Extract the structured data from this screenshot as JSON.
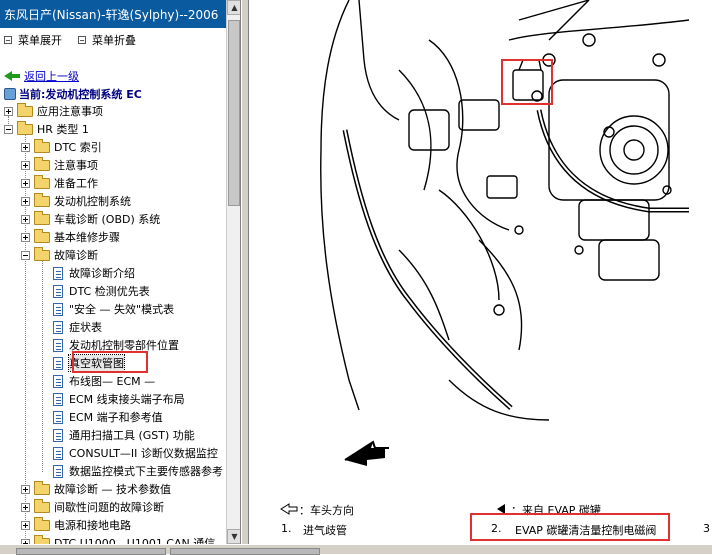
{
  "window": {
    "title": "东风日产(Nissan)-轩逸(Sylphy)--2006"
  },
  "toolbar": {
    "expand_label": "菜单展开",
    "collapse_label": "菜单折叠"
  },
  "nav": {
    "back_label": "返回上一级",
    "current_label": "当前:发动机控制系统 EC"
  },
  "tree": {
    "n0": "应用注意事项",
    "n1": "HR 类型 1",
    "n2": "DTC 索引",
    "n3": "注意事项",
    "n4": "准备工作",
    "n5": "发动机控制系统",
    "n6": "车载诊断 (OBD) 系统",
    "n7": "基本维修步骤",
    "n8": "故障诊断",
    "d0": "故障诊断介绍",
    "d1": "DTC 检测优先表",
    "d2": "\"安全 — 失效\"模式表",
    "d3": "症状表",
    "d4": "发动机控制零部件位置",
    "d5": "真空软管图",
    "d6": "布线图— ECM —",
    "d7": "ECM 线束接头端子布局",
    "d8": "ECM 端子和参考值",
    "d9": "通用扫描工具 (GST) 功能",
    "d10": "CONSULT—II 诊断仪数据监控",
    "d11": "数据监控模式下主要传感器参考",
    "n9": "故障诊断 — 技术参数值",
    "n10": "间歇性问题的故障诊断",
    "n11": "电源和接地电路",
    "n12": "DTC U1000，U1001 CAN 通信"
  },
  "diagram": {
    "legend_front": "：车头方向",
    "legend_from_evap": "：来自 EVAP 碳罐",
    "item1_num": "1.",
    "item1_label": "进气歧管",
    "item2_num": "2.",
    "item2_label": "EVAP 碳罐清洁量控制电磁阀",
    "item3_num": "3"
  },
  "colors": {
    "title_bar": "#0a5aa0",
    "highlight_red": "#e03030",
    "link_blue": "#0000cc",
    "back_green": "#1e9a1e"
  }
}
